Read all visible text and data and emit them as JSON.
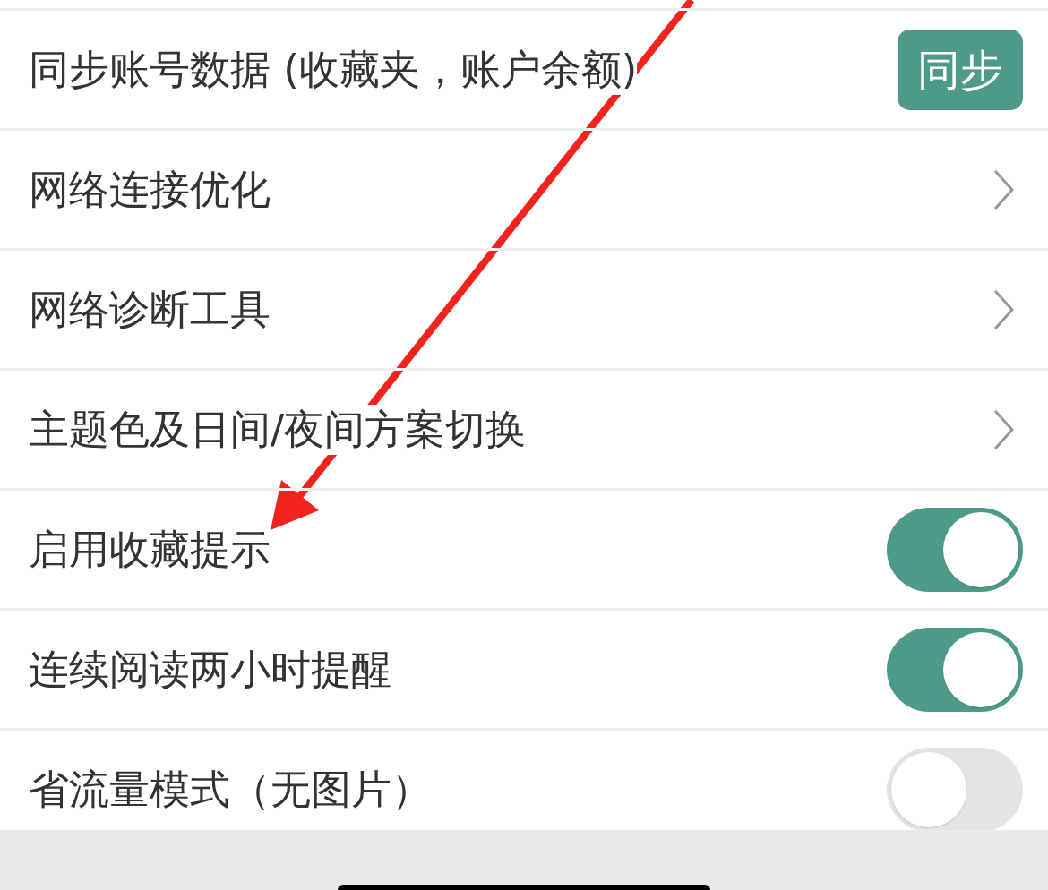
{
  "settings": [
    {
      "kind": "button",
      "label": "同步账号数据 (收藏夹，账户余额)",
      "button": "同步"
    },
    {
      "kind": "link",
      "label": "网络连接优化"
    },
    {
      "kind": "link",
      "label": "网络诊断工具"
    },
    {
      "kind": "link",
      "label": "主题色及日间/夜间方案切换"
    },
    {
      "kind": "toggle",
      "label": "启用收藏提示",
      "on": true
    },
    {
      "kind": "toggle",
      "label": "连续阅读两小时提醒",
      "on": true
    },
    {
      "kind": "toggle",
      "label": "省流量模式（无图片）",
      "on": false
    }
  ]
}
